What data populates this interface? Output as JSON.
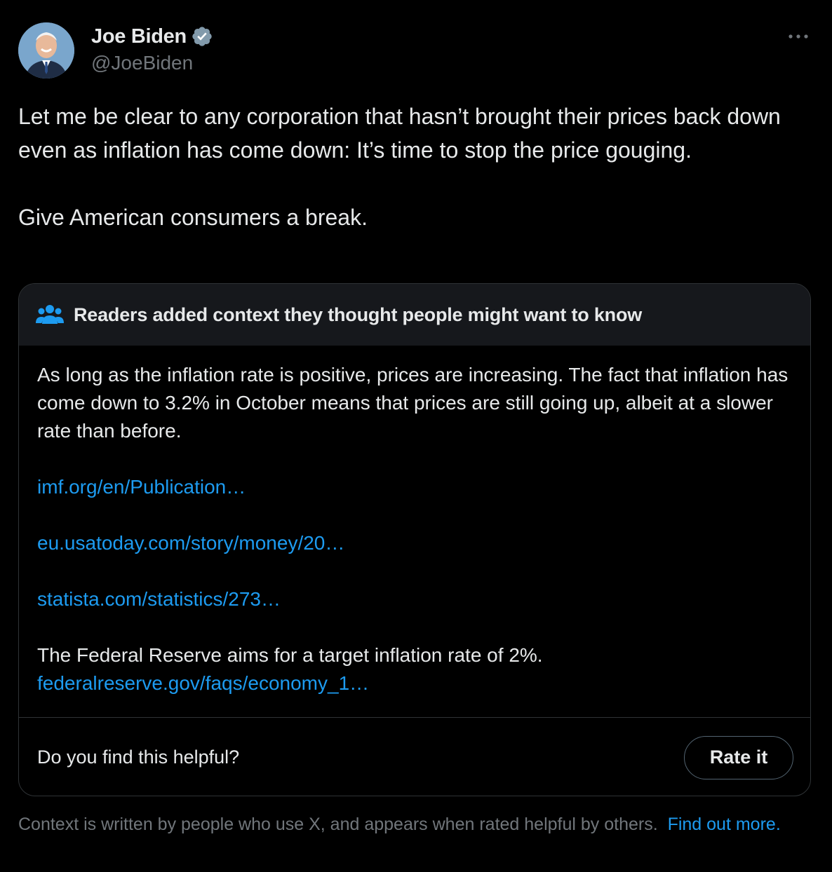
{
  "author": {
    "name": "Joe Biden",
    "handle": "@JoeBiden",
    "verified": true
  },
  "tweet": {
    "paragraphs": [
      "Let me be clear to any corporation that hasn’t brought their prices back down even as inflation has come down: It’s time to stop the price gouging.",
      "Give American consumers a break."
    ]
  },
  "community_note": {
    "title": "Readers added context they thought people might want to know",
    "body": "As long as the inflation rate is positive, prices are increasing. The fact that inflation has come down to 3.2% in October means that prices are still going up, albeit at a slower rate than before.",
    "links": [
      "imf.org/en/Publication…",
      "eu.usatoday.com/story/money/20…",
      "statista.com/statistics/273…"
    ],
    "fed_text": "The Federal Reserve aims for a target inflation rate of 2%.",
    "fed_link": "federalreserve.gov/faqs/economy_1…",
    "helpful_question": "Do you find this helpful?",
    "rate_button": "Rate it"
  },
  "disclaimer": {
    "text": "Context is written by people who use X, and appears when rated helpful by others.",
    "link": "Find out more."
  },
  "icons": {
    "verified": "verified-badge-icon",
    "more": "more-horizontal-icon",
    "people": "people-icon"
  },
  "colors": {
    "background": "#000000",
    "text": "#e7e9ea",
    "secondary": "#71767b",
    "link": "#1d9bf0",
    "note_header_bg": "#16181c",
    "border": "#2f3336"
  }
}
